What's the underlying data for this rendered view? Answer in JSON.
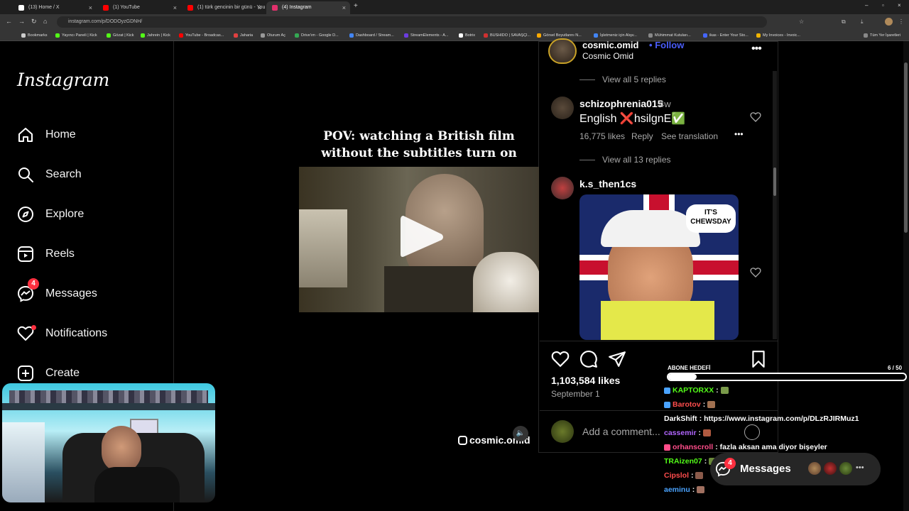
{
  "browser": {
    "tabs": [
      {
        "label": "(13) Home / X",
        "color": "#ffffff"
      },
      {
        "label": "(1) YouTube",
        "color": "#ff0000"
      },
      {
        "label": "(1) türk gencinin bir günü - You",
        "color": "#ff0000"
      },
      {
        "label": "(4) Instagram",
        "color": "#e1306c"
      }
    ],
    "new_tab": "+",
    "url": "instagram.com/p/DODOyzGDNH/",
    "bookmarks": [
      {
        "label": "Bookmarks",
        "color": "#cccccc"
      },
      {
        "label": "Yayıncı Paneli | Kick",
        "color": "#53fc18"
      },
      {
        "label": "Gözat | Kick",
        "color": "#53fc18"
      },
      {
        "label": "Jahrein | Kick",
        "color": "#53fc18"
      },
      {
        "label": "YouTube - Broadcas...",
        "color": "#ff0000"
      },
      {
        "label": "Jaharia",
        "color": "#e04040"
      },
      {
        "label": "Oturum Aç",
        "color": "#999999"
      },
      {
        "label": "Drive'ım - Google D...",
        "color": "#34a853"
      },
      {
        "label": "Dashboard / Stream...",
        "color": "#4285f4"
      },
      {
        "label": "StreamElements - A...",
        "color": "#6c3ce0"
      },
      {
        "label": "Botrix",
        "color": "#ffffff"
      },
      {
        "label": "BUSHIDO | SAVAŞÇI...",
        "color": "#d03030"
      },
      {
        "label": "Görsel Boyutlannı N...",
        "color": "#ffaa00"
      },
      {
        "label": "İşletmeniz için Alışv...",
        "color": "#4285f4"
      },
      {
        "label": "Mühimmat Kutuları...",
        "color": "#888888"
      },
      {
        "label": "ikas - Enter Your Sto...",
        "color": "#4466ff"
      },
      {
        "label": "My Invoices - Invoic...",
        "color": "#f0b400"
      }
    ],
    "all_bookmarks": "Tüm Yer İşaretleri"
  },
  "instagram": {
    "logo": "Instagram",
    "nav": [
      {
        "label": "Home",
        "icon": "home-icon"
      },
      {
        "label": "Search",
        "icon": "search-icon"
      },
      {
        "label": "Explore",
        "icon": "explore-icon"
      },
      {
        "label": "Reels",
        "icon": "reels-icon"
      },
      {
        "label": "Messages",
        "icon": "messages-icon",
        "badge": "4"
      },
      {
        "label": "Notifications",
        "icon": "heart-icon"
      },
      {
        "label": "Create",
        "icon": "create-icon"
      }
    ],
    "post": {
      "username": "cosmic.omid",
      "follow": "Follow",
      "separator": "•",
      "subtitle": "Cosmic Omid",
      "video_caption": "POV: watching a British film without the subtitles turn on",
      "video_handle": "cosmic.omid",
      "likes": "1,103,584 likes",
      "date": "September 1",
      "add_comment_placeholder": "Add a comment...",
      "comments": {
        "view_replies_top": "View all 5 replies",
        "c1_user": "schizophrenia015",
        "c1_time": "4w",
        "c1_text": "English ❌hsilgnE✅",
        "c1_likes": "16,775 likes",
        "c1_reply": "Reply",
        "c1_translate": "See translation",
        "c1_view_replies": "View all 13 replies",
        "c2_user": "k.s_then1cs",
        "c2_image_text": "IT'S CHEWSDAY"
      }
    },
    "messages_pill": {
      "label": "Messages",
      "badge": "4"
    }
  },
  "stream_overlay": {
    "sub_goal": {
      "title": "ABONE HEDEFİ",
      "count": "6 / 50",
      "progress": 0.12
    },
    "chat": [
      {
        "user": "KAPTORXX",
        "sep": ":",
        "msg": "",
        "user_color": "#53fc18",
        "icon_color": "#4aa3ff"
      },
      {
        "user": "Barotov",
        "sep": ":",
        "msg": "",
        "user_color": "#ff4d4d",
        "icon_color": "#4aa3ff"
      },
      {
        "user": "DarkShift",
        "sep": ":",
        "msg": "https://www.instagram.com/p/DLzRJIRMuz1",
        "user_color": "#ffffff",
        "icon_color": ""
      },
      {
        "user": "cassemir",
        "sep": ":",
        "msg": "",
        "user_color": "#b266ff",
        "icon_color": ""
      },
      {
        "user": "orhanscroll",
        "sep": ":",
        "msg": "fazla aksan ama diyor bişeyler",
        "user_color": "#ff4d8a",
        "icon_color": "#ff4d8a"
      },
      {
        "user": "TRAizen07",
        "sep": ":",
        "msg": "",
        "user_color": "#53fc18",
        "icon_color": ""
      },
      {
        "user": "Cipslol",
        "sep": ":",
        "msg": "",
        "user_color": "#ff4d4d",
        "icon_color": ""
      },
      {
        "user": "aeminu",
        "sep": ":",
        "msg": "",
        "user_color": "#4aa3ff",
        "icon_color": ""
      }
    ]
  }
}
